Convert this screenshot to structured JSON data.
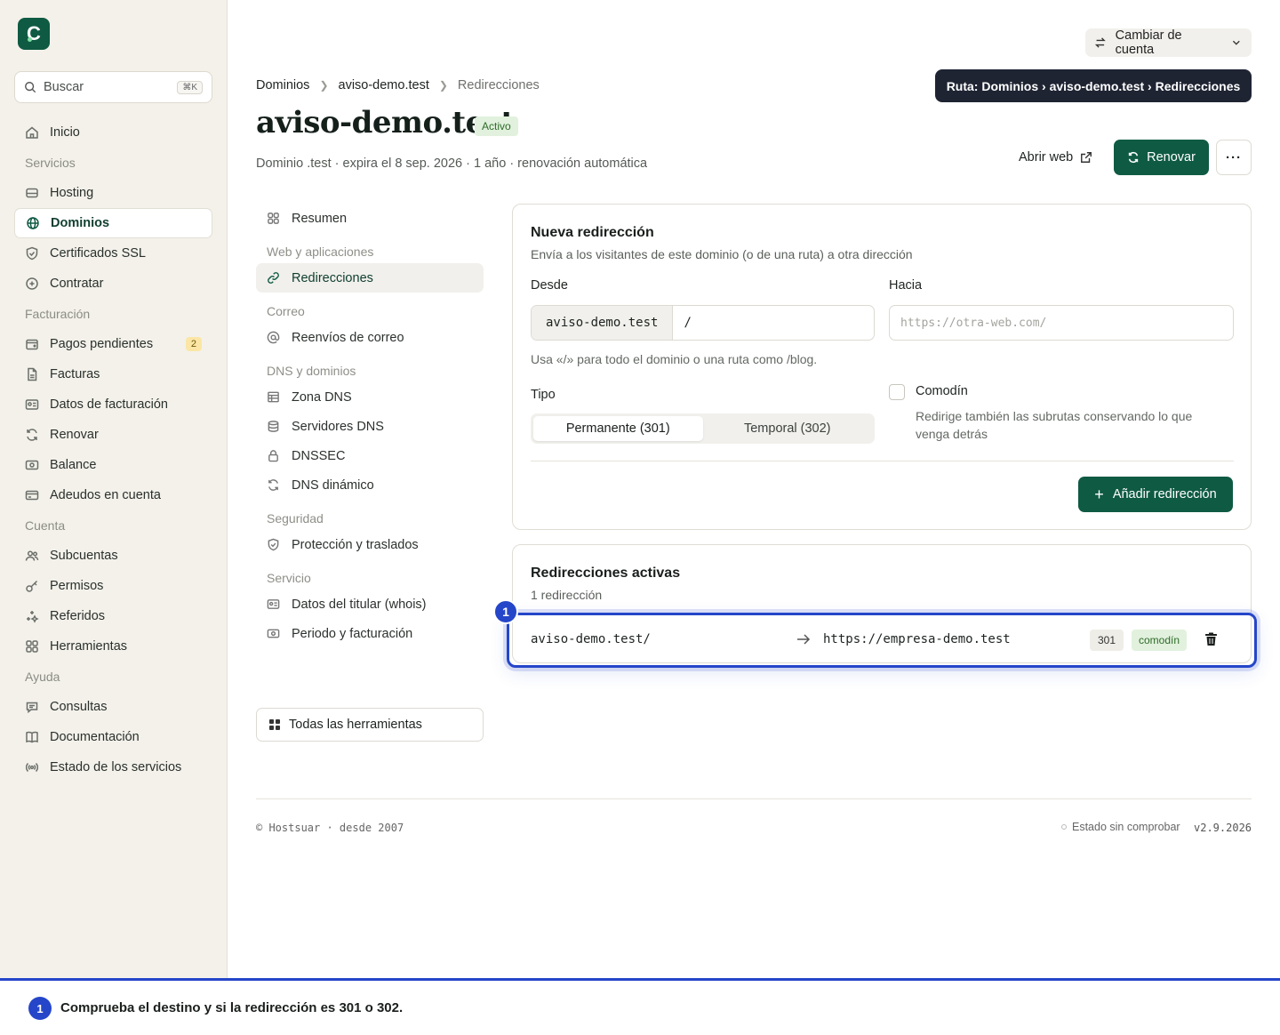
{
  "sidebar": {
    "search_placeholder": "Buscar",
    "search_shortcut": "⌘K",
    "items": [
      {
        "type": "item",
        "label": "Inicio",
        "icon": "home-icon"
      },
      {
        "type": "section",
        "label": "Servicios"
      },
      {
        "type": "item",
        "label": "Hosting",
        "icon": "server-icon"
      },
      {
        "type": "item",
        "label": "Dominios",
        "icon": "globe-icon",
        "active": true
      },
      {
        "type": "item",
        "label": "Certificados SSL",
        "icon": "shield-icon"
      },
      {
        "type": "item",
        "label": "Contratar",
        "icon": "plus-circle-icon"
      },
      {
        "type": "section",
        "label": "Facturación"
      },
      {
        "type": "item",
        "label": "Pagos pendientes",
        "icon": "wallet-icon",
        "badge": "2"
      },
      {
        "type": "item",
        "label": "Facturas",
        "icon": "file-icon"
      },
      {
        "type": "item",
        "label": "Datos de facturación",
        "icon": "id-card-icon"
      },
      {
        "type": "item",
        "label": "Renovar",
        "icon": "refresh-icon"
      },
      {
        "type": "item",
        "label": "Balance",
        "icon": "banknote-icon"
      },
      {
        "type": "item",
        "label": "Adeudos en cuenta",
        "icon": "credit-card-icon"
      },
      {
        "type": "section",
        "label": "Cuenta"
      },
      {
        "type": "item",
        "label": "Subcuentas",
        "icon": "users-icon"
      },
      {
        "type": "item",
        "label": "Permisos",
        "icon": "key-icon"
      },
      {
        "type": "item",
        "label": "Referidos",
        "icon": "sparkles-icon"
      },
      {
        "type": "item",
        "label": "Herramientas",
        "icon": "grid-icon"
      },
      {
        "type": "section",
        "label": "Ayuda"
      },
      {
        "type": "item",
        "label": "Consultas",
        "icon": "chat-icon"
      },
      {
        "type": "item",
        "label": "Documentación",
        "icon": "book-icon"
      },
      {
        "type": "item",
        "label": "Estado de los servicios",
        "icon": "radio-icon"
      }
    ]
  },
  "header": {
    "account_switcher": "Cambiar de cuenta",
    "tooltip": "Ruta: Dominios › aviso-demo.test › Redirecciones",
    "breadcrumb": [
      "Dominios",
      "aviso-demo.test",
      "Redirecciones"
    ],
    "title": "aviso-demo.test",
    "status": "Activo",
    "subtitle": "Dominio .test · expira el 8 sep. 2026 · 1 año · renovación automática",
    "open_web": "Abrir web",
    "renew": "Renovar",
    "more": "···"
  },
  "subnav": {
    "items": [
      {
        "type": "item",
        "label": "Resumen",
        "icon": "grid-icon"
      },
      {
        "type": "section",
        "label": "Web y aplicaciones"
      },
      {
        "type": "item",
        "label": "Redirecciones",
        "icon": "link-icon",
        "active": true
      },
      {
        "type": "section",
        "label": "Correo"
      },
      {
        "type": "item",
        "label": "Reenvíos de correo",
        "icon": "at-icon"
      },
      {
        "type": "section",
        "label": "DNS y dominios"
      },
      {
        "type": "item",
        "label": "Zona DNS",
        "icon": "table-icon"
      },
      {
        "type": "item",
        "label": "Servidores DNS",
        "icon": "database-icon"
      },
      {
        "type": "item",
        "label": "DNSSEC",
        "icon": "lock-icon"
      },
      {
        "type": "item",
        "label": "DNS dinámico",
        "icon": "refresh-icon"
      },
      {
        "type": "section",
        "label": "Seguridad"
      },
      {
        "type": "item",
        "label": "Protección y traslados",
        "icon": "shield-icon"
      },
      {
        "type": "section",
        "label": "Servicio"
      },
      {
        "type": "item",
        "label": "Datos del titular (whois)",
        "icon": "id-card-icon"
      },
      {
        "type": "item",
        "label": "Periodo y facturación",
        "icon": "banknote-icon"
      }
    ],
    "all_tools": "Todas las herramientas"
  },
  "new_redirect": {
    "title": "Nueva redirección",
    "description": "Envía a los visitantes de este dominio (o de una ruta) a otra dirección",
    "from_label": "Desde",
    "from_prefix": "aviso-demo.test",
    "from_path": "/",
    "to_label": "Hacia",
    "to_placeholder": "https://otra-web.com/",
    "hint": "Usa «/» para todo el dominio o una ruta como /blog.",
    "type_label": "Tipo",
    "type_options": [
      "Permanente (301)",
      "Temporal (302)"
    ],
    "type_selected": "Permanente (301)",
    "wildcard_label": "Comodín",
    "wildcard_description": "Redirige también las subrutas conservando lo que venga detrás",
    "wildcard_checked": false,
    "add_button": "Añadir redirección"
  },
  "active_redirects": {
    "title": "Redirecciones activas",
    "count": "1 redirección",
    "rows": [
      {
        "from": "aviso-demo.test/",
        "to": "https://empresa-demo.test",
        "code": "301",
        "tag": "comodín"
      }
    ]
  },
  "footer": {
    "copyright": "© Hostsuar · desde 2007",
    "status": "Estado sin comprobar",
    "version": "v2.9.2026"
  },
  "annotation": {
    "marker": "1",
    "text": "Comprueba el destino y si la redirección es 301 o 302."
  },
  "colors": {
    "brand": "#0f5a43",
    "highlight": "#2546c9",
    "sidebar_bg": "#f3f1ea"
  }
}
